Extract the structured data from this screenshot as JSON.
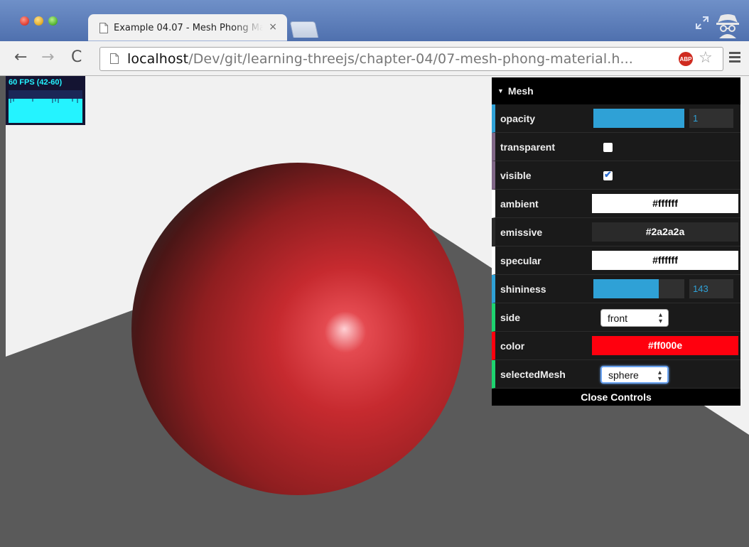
{
  "browser": {
    "tab_title": "Example 04.07 - Mesh Phong Material",
    "tab_close": "×",
    "url_host": "localhost",
    "url_path": "/Dev/git/learning-threejs/chapter-04/07-mesh-phong-material.h...",
    "abp_label": "ABP",
    "icons": {
      "back": "←",
      "forward": "→",
      "reload": "C",
      "star": "☆"
    }
  },
  "stats": {
    "label": "60 FPS (42-60)"
  },
  "gui": {
    "folder_title": "Mesh",
    "close_label": "Close Controls",
    "opacity": {
      "label": "opacity",
      "value": "1",
      "fraction": 1.0
    },
    "transparent": {
      "label": "transparent",
      "checked": false
    },
    "visible": {
      "label": "visible",
      "checked": true
    },
    "ambient": {
      "label": "ambient",
      "value": "#ffffff"
    },
    "emissive": {
      "label": "emissive",
      "value": "#2a2a2a"
    },
    "specular": {
      "label": "specular",
      "value": "#ffffff"
    },
    "shininess": {
      "label": "shininess",
      "value": "143",
      "fraction": 0.72
    },
    "side": {
      "label": "side",
      "value": "front"
    },
    "color": {
      "label": "color",
      "value": "#ff000e"
    },
    "selectedMesh": {
      "label": "selectedMesh",
      "value": "sphere"
    }
  },
  "colors": {
    "accent_number": "#2fa1d6",
    "accent_boolean": "#806787",
    "accent_option": "#1ed36f",
    "sphere": "#c62828",
    "background": "#f1f1f1",
    "ground": "#5a5a5a"
  }
}
